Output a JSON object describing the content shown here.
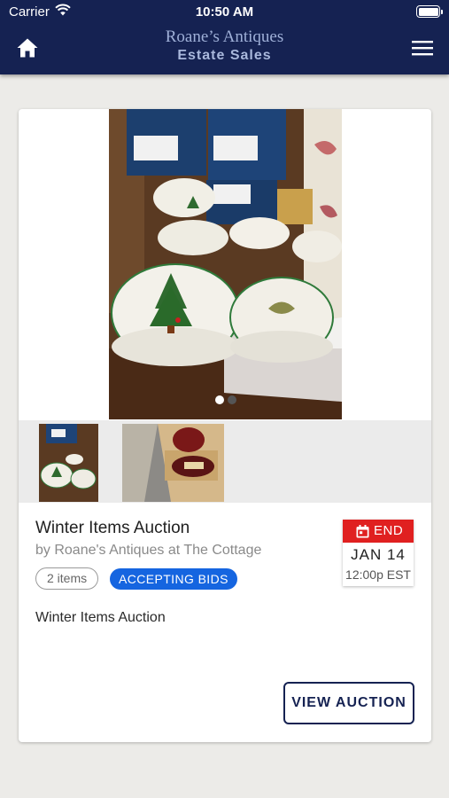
{
  "status_bar": {
    "carrier": "Carrier",
    "time": "10:50 AM"
  },
  "header": {
    "brand_title": "Roane’s Antiques",
    "brand_subtitle": "Estate Sales",
    "home_icon": "home-icon",
    "menu_icon": "hamburger-menu-icon",
    "background_color": "#152252"
  },
  "auction": {
    "carousel": {
      "slide_count": 2,
      "active_slide": 1
    },
    "thumbnails": [
      "Christmas tree dinnerware set",
      "Wooden display shelf with sign"
    ],
    "title": "Winter Items Auction",
    "organizer": "by Roane's Antiques at The Cottage",
    "items_count": "2 items",
    "status": "ACCEPTING BIDS",
    "status_color": "#1565e0",
    "end_date": {
      "label": "END",
      "day": "JAN 14",
      "time": "12:00p EST",
      "color": "#e02020"
    },
    "description": "Winter Items Auction",
    "view_button": "VIEW AUCTION"
  }
}
